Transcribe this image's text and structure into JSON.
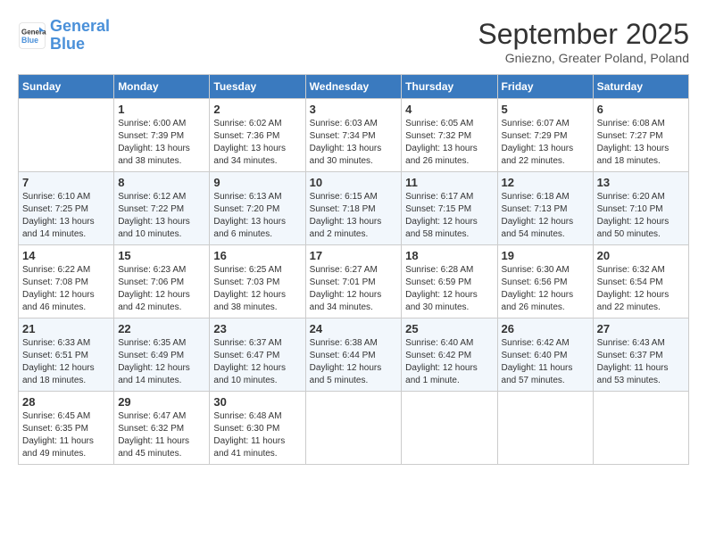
{
  "header": {
    "logo_line1": "General",
    "logo_line2": "Blue",
    "month_title": "September 2025",
    "location": "Gniezno, Greater Poland, Poland"
  },
  "days_of_week": [
    "Sunday",
    "Monday",
    "Tuesday",
    "Wednesday",
    "Thursday",
    "Friday",
    "Saturday"
  ],
  "weeks": [
    [
      {
        "day": "",
        "info": ""
      },
      {
        "day": "1",
        "info": "Sunrise: 6:00 AM\nSunset: 7:39 PM\nDaylight: 13 hours\nand 38 minutes."
      },
      {
        "day": "2",
        "info": "Sunrise: 6:02 AM\nSunset: 7:36 PM\nDaylight: 13 hours\nand 34 minutes."
      },
      {
        "day": "3",
        "info": "Sunrise: 6:03 AM\nSunset: 7:34 PM\nDaylight: 13 hours\nand 30 minutes."
      },
      {
        "day": "4",
        "info": "Sunrise: 6:05 AM\nSunset: 7:32 PM\nDaylight: 13 hours\nand 26 minutes."
      },
      {
        "day": "5",
        "info": "Sunrise: 6:07 AM\nSunset: 7:29 PM\nDaylight: 13 hours\nand 22 minutes."
      },
      {
        "day": "6",
        "info": "Sunrise: 6:08 AM\nSunset: 7:27 PM\nDaylight: 13 hours\nand 18 minutes."
      }
    ],
    [
      {
        "day": "7",
        "info": "Sunrise: 6:10 AM\nSunset: 7:25 PM\nDaylight: 13 hours\nand 14 minutes."
      },
      {
        "day": "8",
        "info": "Sunrise: 6:12 AM\nSunset: 7:22 PM\nDaylight: 13 hours\nand 10 minutes."
      },
      {
        "day": "9",
        "info": "Sunrise: 6:13 AM\nSunset: 7:20 PM\nDaylight: 13 hours\nand 6 minutes."
      },
      {
        "day": "10",
        "info": "Sunrise: 6:15 AM\nSunset: 7:18 PM\nDaylight: 13 hours\nand 2 minutes."
      },
      {
        "day": "11",
        "info": "Sunrise: 6:17 AM\nSunset: 7:15 PM\nDaylight: 12 hours\nand 58 minutes."
      },
      {
        "day": "12",
        "info": "Sunrise: 6:18 AM\nSunset: 7:13 PM\nDaylight: 12 hours\nand 54 minutes."
      },
      {
        "day": "13",
        "info": "Sunrise: 6:20 AM\nSunset: 7:10 PM\nDaylight: 12 hours\nand 50 minutes."
      }
    ],
    [
      {
        "day": "14",
        "info": "Sunrise: 6:22 AM\nSunset: 7:08 PM\nDaylight: 12 hours\nand 46 minutes."
      },
      {
        "day": "15",
        "info": "Sunrise: 6:23 AM\nSunset: 7:06 PM\nDaylight: 12 hours\nand 42 minutes."
      },
      {
        "day": "16",
        "info": "Sunrise: 6:25 AM\nSunset: 7:03 PM\nDaylight: 12 hours\nand 38 minutes."
      },
      {
        "day": "17",
        "info": "Sunrise: 6:27 AM\nSunset: 7:01 PM\nDaylight: 12 hours\nand 34 minutes."
      },
      {
        "day": "18",
        "info": "Sunrise: 6:28 AM\nSunset: 6:59 PM\nDaylight: 12 hours\nand 30 minutes."
      },
      {
        "day": "19",
        "info": "Sunrise: 6:30 AM\nSunset: 6:56 PM\nDaylight: 12 hours\nand 26 minutes."
      },
      {
        "day": "20",
        "info": "Sunrise: 6:32 AM\nSunset: 6:54 PM\nDaylight: 12 hours\nand 22 minutes."
      }
    ],
    [
      {
        "day": "21",
        "info": "Sunrise: 6:33 AM\nSunset: 6:51 PM\nDaylight: 12 hours\nand 18 minutes."
      },
      {
        "day": "22",
        "info": "Sunrise: 6:35 AM\nSunset: 6:49 PM\nDaylight: 12 hours\nand 14 minutes."
      },
      {
        "day": "23",
        "info": "Sunrise: 6:37 AM\nSunset: 6:47 PM\nDaylight: 12 hours\nand 10 minutes."
      },
      {
        "day": "24",
        "info": "Sunrise: 6:38 AM\nSunset: 6:44 PM\nDaylight: 12 hours\nand 5 minutes."
      },
      {
        "day": "25",
        "info": "Sunrise: 6:40 AM\nSunset: 6:42 PM\nDaylight: 12 hours\nand 1 minute."
      },
      {
        "day": "26",
        "info": "Sunrise: 6:42 AM\nSunset: 6:40 PM\nDaylight: 11 hours\nand 57 minutes."
      },
      {
        "day": "27",
        "info": "Sunrise: 6:43 AM\nSunset: 6:37 PM\nDaylight: 11 hours\nand 53 minutes."
      }
    ],
    [
      {
        "day": "28",
        "info": "Sunrise: 6:45 AM\nSunset: 6:35 PM\nDaylight: 11 hours\nand 49 minutes."
      },
      {
        "day": "29",
        "info": "Sunrise: 6:47 AM\nSunset: 6:32 PM\nDaylight: 11 hours\nand 45 minutes."
      },
      {
        "day": "30",
        "info": "Sunrise: 6:48 AM\nSunset: 6:30 PM\nDaylight: 11 hours\nand 41 minutes."
      },
      {
        "day": "",
        "info": ""
      },
      {
        "day": "",
        "info": ""
      },
      {
        "day": "",
        "info": ""
      },
      {
        "day": "",
        "info": ""
      }
    ]
  ]
}
